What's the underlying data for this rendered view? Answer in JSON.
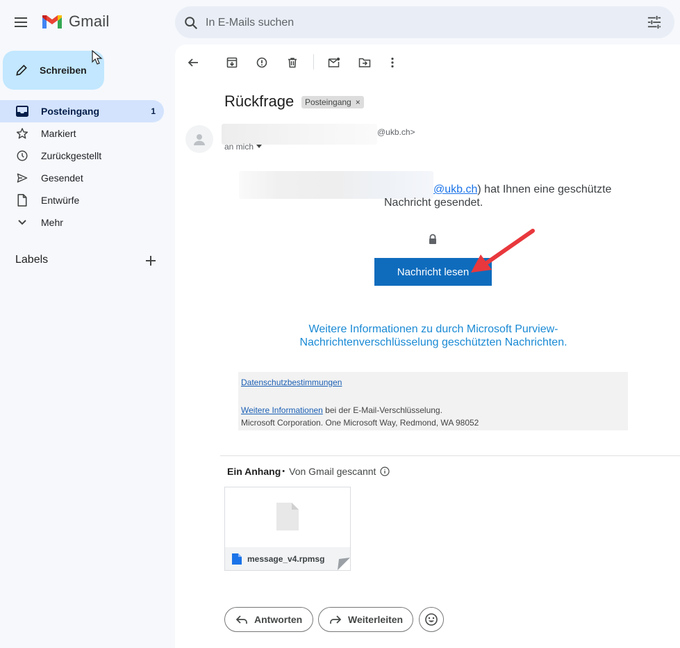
{
  "app": {
    "name": "Gmail"
  },
  "search": {
    "placeholder": "In E-Mails suchen"
  },
  "sidebar": {
    "compose_label": "Schreiben",
    "items": [
      {
        "label": "Posteingang",
        "count": "1",
        "icon": "inbox-icon",
        "active": true
      },
      {
        "label": "Markiert",
        "icon": "star-icon"
      },
      {
        "label": "Zurückgestellt",
        "icon": "clock-icon"
      },
      {
        "label": "Gesendet",
        "icon": "send-icon"
      },
      {
        "label": "Entwürfe",
        "icon": "draft-icon"
      },
      {
        "label": "Mehr",
        "icon": "chevron-down-icon"
      }
    ],
    "labels_title": "Labels"
  },
  "email": {
    "subject": "Rückfrage",
    "label_chip": "Posteingang",
    "label_chip_close": "×",
    "sender_domain": "@ukb.ch>",
    "to": "an mich",
    "body": {
      "line1_link": "@ukb.ch",
      "line1_rest": ") hat Ihnen eine geschützte",
      "line2": "Nachricht gesendet.",
      "read_button": "Nachricht lesen",
      "purview_line1": "Weitere Informationen zu durch Microsoft Purview-",
      "purview_line2": "Nachrichtenverschlüsselung geschützten Nachrichten.",
      "privacy_link": "Datenschutzbestimmungen",
      "more_info_link": "Weitere Informationen",
      "more_info_rest": " bei der E-Mail-Verschlüsselung.",
      "address": "Microsoft Corporation. One Microsoft Way, Redmond, WA 98052"
    },
    "attachments": {
      "header": "Ein Anhang",
      "dot": "•",
      "scanned": "Von Gmail gescannt",
      "file_name": "message_v4.rpmsg"
    },
    "actions": {
      "reply": "Antworten",
      "forward": "Weiterleiten"
    }
  },
  "colors": {
    "accent_blue": "#0f6cbd",
    "compose_bg": "#c2e7ff",
    "active_nav_bg": "#d3e3fd",
    "annotation_arrow": "#e8383d"
  }
}
